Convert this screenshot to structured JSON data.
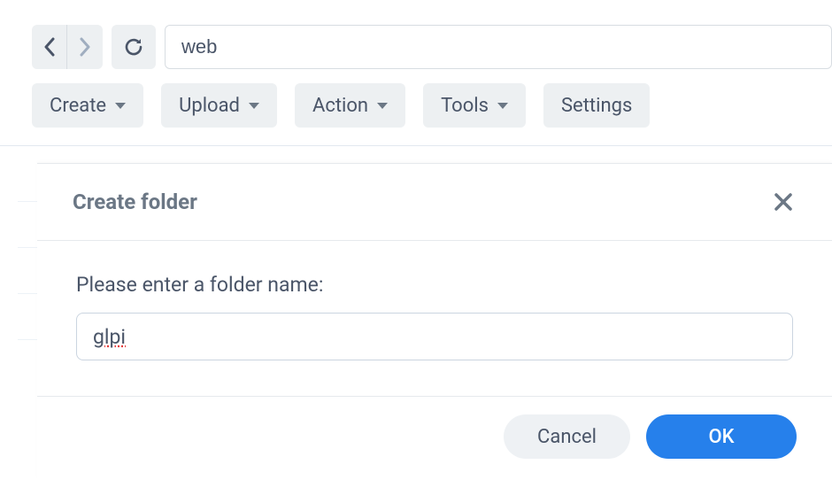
{
  "nav": {
    "path_value": "web"
  },
  "toolbar": {
    "create_label": "Create",
    "upload_label": "Upload",
    "action_label": "Action",
    "tools_label": "Tools",
    "settings_label": "Settings"
  },
  "modal": {
    "title": "Create folder",
    "prompt_label": "Please enter a folder name:",
    "input_value": "glpi",
    "cancel_label": "Cancel",
    "ok_label": "OK"
  }
}
